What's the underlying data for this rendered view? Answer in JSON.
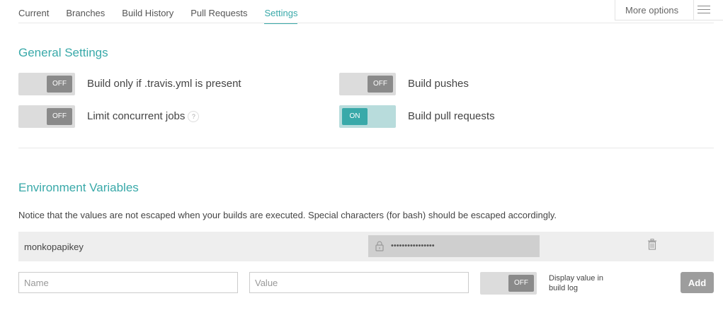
{
  "tabs": [
    {
      "label": "Current"
    },
    {
      "label": "Branches"
    },
    {
      "label": "Build History"
    },
    {
      "label": "Pull Requests"
    },
    {
      "label": "Settings"
    }
  ],
  "more_options": {
    "label": "More options",
    "icon": "menu-icon"
  },
  "general": {
    "title": "General Settings",
    "settings": [
      {
        "label": "Build only if .travis.yml is present",
        "state": "OFF"
      },
      {
        "label": "Build pushes",
        "state": "OFF"
      },
      {
        "label": "Limit concurrent jobs",
        "state": "OFF",
        "help": "?"
      },
      {
        "label": "Build pull requests",
        "state": "ON"
      }
    ]
  },
  "env": {
    "title": "Environment Variables",
    "notice": "Notice that the values are not escaped when your builds are executed. Special characters (for bash) should be escaped accordingly.",
    "variables": [
      {
        "name": "monkopapikey",
        "value": "••••••••••••••••"
      }
    ],
    "form": {
      "name_placeholder": "Name",
      "value_placeholder": "Value",
      "display_toggle": "OFF",
      "display_label": "Display value in build log",
      "add_label": "Add"
    }
  },
  "colors": {
    "accent": "#39a9a9",
    "toggle_off": "#8a8a8a",
    "button": "#9d9d9d"
  }
}
